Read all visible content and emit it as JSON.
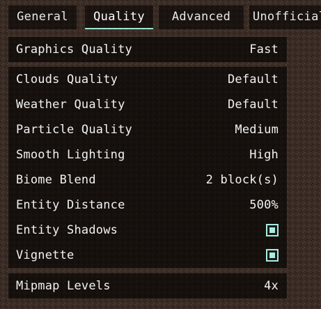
{
  "tabs": [
    {
      "label": "General"
    },
    {
      "label": "Quality",
      "active": true
    },
    {
      "label": "Advanced"
    },
    {
      "label": "Unofficial"
    }
  ],
  "graphics_quality": {
    "label": "Graphics Quality",
    "value": "Fast"
  },
  "settings": [
    {
      "label": "Clouds Quality",
      "value": "Default"
    },
    {
      "label": "Weather Quality",
      "value": "Default"
    },
    {
      "label": "Particle Quality",
      "value": "Medium"
    },
    {
      "label": "Smooth Lighting",
      "value": "High"
    },
    {
      "label": "Biome Blend",
      "value": "2 block(s)"
    },
    {
      "label": "Entity Distance",
      "value": "500%"
    },
    {
      "label": "Entity Shadows",
      "checked": true
    },
    {
      "label": "Vignette",
      "checked": true
    }
  ],
  "mipmap": {
    "label": "Mipmap Levels",
    "value": "4x"
  },
  "colors": {
    "accent": "#9fe3d6",
    "checkbox": "#a7ede0",
    "text": "#f2f2f2"
  }
}
